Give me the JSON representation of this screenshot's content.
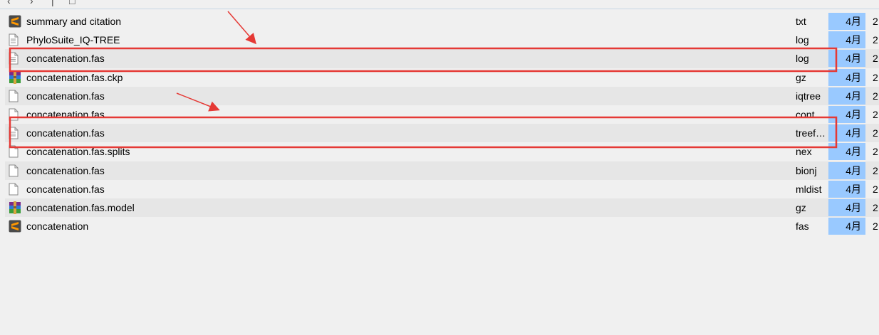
{
  "colors": {
    "highlight": "#e53935",
    "date_bg": "#99c9ff",
    "alt_row": "#e6e6e6"
  },
  "files": [
    {
      "name": "summary and citation",
      "ext": "txt",
      "date": "4月",
      "more": "2",
      "icon": "sublime-text-icon",
      "alt": false
    },
    {
      "name": "PhyloSuite_IQ-TREE",
      "ext": "log",
      "date": "4月",
      "more": "2",
      "icon": "text-file-icon",
      "alt": false
    },
    {
      "name": "concatenation.fas",
      "ext": "log",
      "date": "4月",
      "more": "2",
      "icon": "text-file-icon",
      "alt": true
    },
    {
      "name": "concatenation.fas.ckp",
      "ext": "gz",
      "date": "4月",
      "more": "2",
      "icon": "winrar-archive-icon",
      "alt": false
    },
    {
      "name": "concatenation.fas",
      "ext": "iqtree",
      "date": "4月",
      "more": "2",
      "icon": "blank-file-icon",
      "alt": true
    },
    {
      "name": "concatenation.fas",
      "ext": "cont",
      "date": "4月",
      "more": "2",
      "icon": "blank-file-icon",
      "alt": false
    },
    {
      "name": "concatenation.fas",
      "ext": "treef…",
      "date": "4月",
      "more": "2",
      "icon": "text-file-icon",
      "alt": true
    },
    {
      "name": "concatenation.fas.splits",
      "ext": "nex",
      "date": "4月",
      "more": "2",
      "icon": "blank-file-icon",
      "alt": false
    },
    {
      "name": "concatenation.fas",
      "ext": "bionj",
      "date": "4月",
      "more": "2",
      "icon": "blank-file-icon",
      "alt": true
    },
    {
      "name": "concatenation.fas",
      "ext": "mldist",
      "date": "4月",
      "more": "2",
      "icon": "blank-file-icon",
      "alt": false
    },
    {
      "name": "concatenation.fas.model",
      "ext": "gz",
      "date": "4月",
      "more": "2",
      "icon": "winrar-archive-icon",
      "alt": true
    },
    {
      "name": "concatenation",
      "ext": "fas",
      "date": "4月",
      "more": "2",
      "icon": "sublime-text-icon",
      "alt": false
    }
  ]
}
